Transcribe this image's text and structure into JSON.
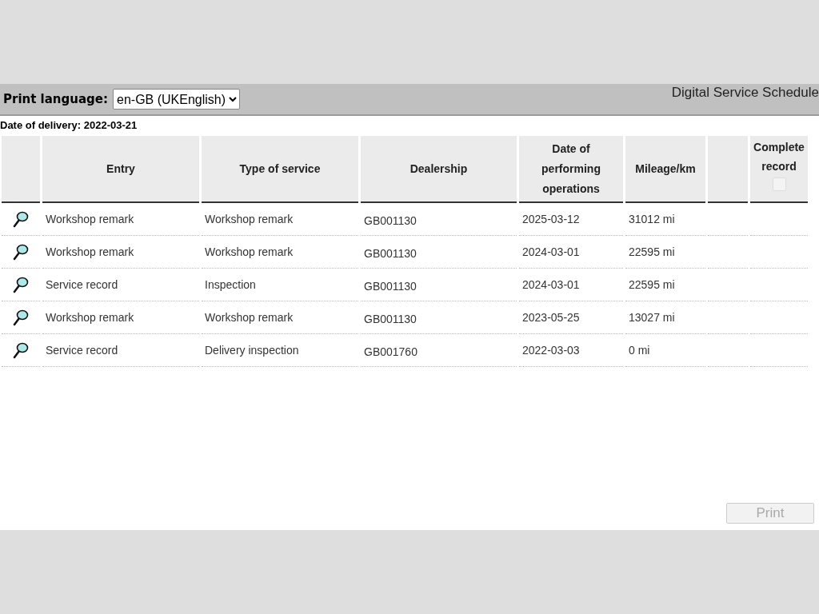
{
  "header": {
    "language_label": "Print language:",
    "language_value": "en-GB (UKEnglish)",
    "title": "Digital Service Schedule"
  },
  "delivery_date": "Date of delivery: 2022-03-21",
  "table": {
    "columns": [
      "Entry",
      "Type of service",
      "Dealership",
      "Date of performing operations",
      "Mileage/km",
      "Complete record"
    ],
    "complete_record_checkbox": {
      "checked": false,
      "disabled": true
    },
    "rows": [
      {
        "entry": "Workshop remark",
        "type": "Workshop remark",
        "dealership": "GB001130",
        "date": "2025-03-12",
        "mileage": "31012 mi"
      },
      {
        "entry": "Workshop remark",
        "type": "Workshop remark",
        "dealership": "GB001130",
        "date": "2024-03-01",
        "mileage": "22595 mi"
      },
      {
        "entry": "Service record",
        "type": "Inspection",
        "dealership": "GB001130",
        "date": "2024-03-01",
        "mileage": "22595 mi"
      },
      {
        "entry": "Workshop remark",
        "type": "Workshop remark",
        "dealership": "GB001130",
        "date": "2023-05-25",
        "mileage": "13027 mi"
      },
      {
        "entry": "Service record",
        "type": "Delivery inspection",
        "dealership": "GB001760",
        "date": "2022-03-03",
        "mileage": "0 mi"
      }
    ]
  },
  "print_button": {
    "label": "Print",
    "disabled": true
  }
}
